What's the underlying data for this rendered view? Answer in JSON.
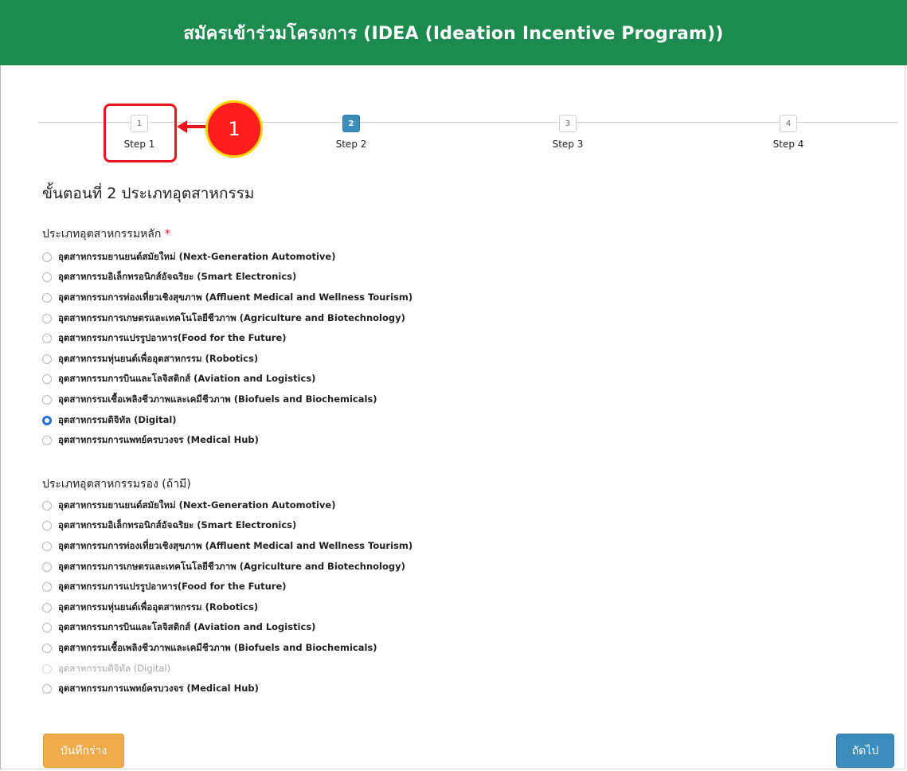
{
  "header": {
    "title": "สมัครเข้าร่วมโครงการ (IDEA (Ideation Incentive Program))"
  },
  "steps": [
    {
      "number": "1",
      "label": "Step 1",
      "active": false
    },
    {
      "number": "2",
      "label": "Step 2",
      "active": true
    },
    {
      "number": "3",
      "label": "Step 3",
      "active": false
    },
    {
      "number": "4",
      "label": "Step 4",
      "active": false
    }
  ],
  "annotation": {
    "callout_number": "1",
    "color": "#e8151b"
  },
  "section_title": "ขั้นตอนที่ 2 ประเภทอุตสาหกรรม",
  "primary": {
    "label": "ประเภทอุตสาหกรรมหลัก",
    "required_mark": "*",
    "selected": "อุตสาหกรรมดิจิทัล (Digital)",
    "options": [
      "อุตสาหกรรมยานยนต์สมัยใหม่ (Next-Generation Automotive)",
      "อุตสาหกรรมอิเล็กทรอนิกส์อัจฉริยะ (Smart Electronics)",
      "อุตสาหกรรมการท่องเที่ยวเชิงสุขภาพ (Affluent Medical and Wellness Tourism)",
      "อุตสาหกรรมการเกษตรและเทคโนโลยีชีวภาพ (Agriculture and Biotechnology)",
      "อุตสาหกรรมการแปรรูปอาหาร(Food for the Future)",
      "อุตสาหกรรมหุ่นยนต์เพื่ออุตสาหกรรม (Robotics)",
      "อุตสาหกรรมการบินและโลจิสติกส์ (Aviation and Logistics)",
      "อุตสาหกรรมเชื้อเพลิงชีวภาพและเคมีชีวภาพ (Biofuels and Biochemicals)",
      "อุตสาหกรรมดิจิทัล (Digital)",
      "อุตสาหกรรมการแพทย์ครบวงจร (Medical Hub)"
    ]
  },
  "secondary": {
    "label": "ประเภทอุตสาหกรรมรอง (ถ้ามี)",
    "disabled": "อุตสาหกรรมดิจิทัล (Digital)",
    "options": [
      "อุตสาหกรรมยานยนต์สมัยใหม่ (Next-Generation Automotive)",
      "อุตสาหกรรมอิเล็กทรอนิกส์อัจฉริยะ (Smart Electronics)",
      "อุตสาหกรรมการท่องเที่ยวเชิงสุขภาพ (Affluent Medical and Wellness Tourism)",
      "อุตสาหกรรมการเกษตรและเทคโนโลยีชีวภาพ (Agriculture and Biotechnology)",
      "อุตสาหกรรมการแปรรูปอาหาร(Food for the Future)",
      "อุตสาหกรรมหุ่นยนต์เพื่ออุตสาหกรรม (Robotics)",
      "อุตสาหกรรมการบินและโลจิสติกส์ (Aviation and Logistics)",
      "อุตสาหกรรมเชื้อเพลิงชีวภาพและเคมีชีวภาพ (Biofuels and Biochemicals)",
      "อุตสาหกรรมดิจิทัล (Digital)",
      "อุตสาหกรรมการแพทย์ครบวงจร (Medical Hub)"
    ]
  },
  "buttons": {
    "save_draft": "บันทึกร่าง",
    "next": "ถัดไป"
  },
  "colors": {
    "header": "#1e8b4e",
    "primary": "#3c8dbc",
    "warning": "#f0ac4b"
  }
}
